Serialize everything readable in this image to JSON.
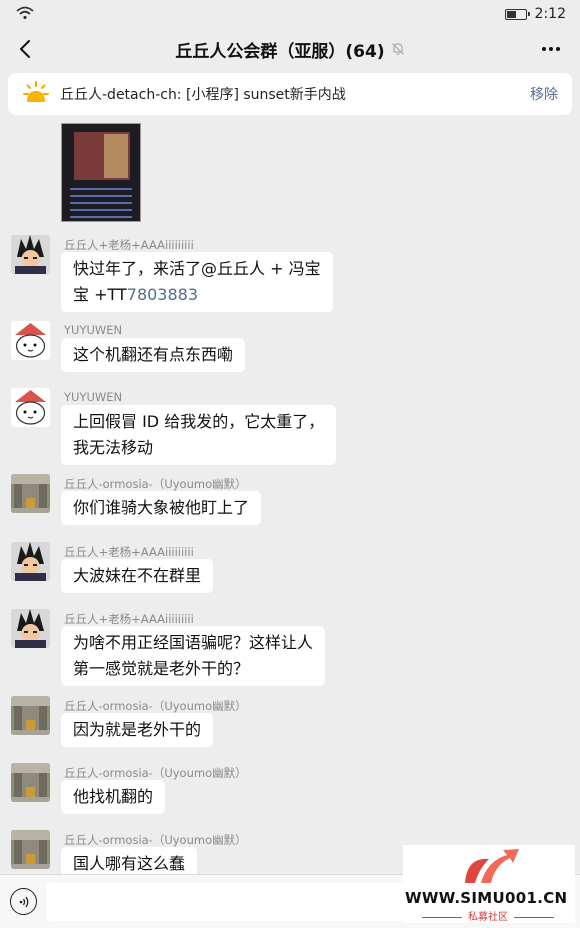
{
  "status_bar": {
    "time": "2:12"
  },
  "header": {
    "title": "丘丘人公会群（亚服）(64)",
    "muted": true
  },
  "pinned": {
    "text": "丘丘人-detach-ch: [小程序] sunset新手内战",
    "action": "移除"
  },
  "messages": [
    {
      "sender": "丘丘人+老杨+AAAiiiiiiiii",
      "avatar": "vegeta-avatar",
      "lines": [
        "快过年了，来活了@丘丘人 + 冯宝",
        "宝 +TT"
      ],
      "link": "7803883"
    },
    {
      "sender": "YUYUWEN",
      "avatar": "rice-hat-avatar",
      "lines": [
        "这个机翻还有点东西嘞"
      ]
    },
    {
      "sender": "YUYUWEN",
      "avatar": "rice-hat-avatar",
      "lines": [
        "上回假冒 ID 给我发的，它太重了，",
        "我无法移动"
      ]
    },
    {
      "sender": "丘丘人-ormosia-（Uyoumo幽默）",
      "avatar": "warehouse-avatar",
      "lines": [
        "你们谁骑大象被他盯上了"
      ]
    },
    {
      "sender": "丘丘人+老杨+AAAiiiiiiiii",
      "avatar": "vegeta-avatar",
      "lines": [
        "大波妹在不在群里"
      ]
    },
    {
      "sender": "丘丘人+老杨+AAAiiiiiiiii",
      "avatar": "vegeta-avatar",
      "lines": [
        "为啥不用正经国语骗呢？这样让人",
        "第一感觉就是老外干的？"
      ]
    },
    {
      "sender": "丘丘人-ormosia-（Uyoumo幽默）",
      "avatar": "warehouse-avatar",
      "lines": [
        "因为就是老外干的"
      ]
    },
    {
      "sender": "丘丘人-ormosia-（Uyoumo幽默）",
      "avatar": "warehouse-avatar",
      "lines": [
        "他找机翻的"
      ]
    },
    {
      "sender": "丘丘人-ormosia-（Uyoumo幽默）",
      "avatar": "warehouse-avatar",
      "lines": [
        "国人哪有这么蠢"
      ]
    }
  ],
  "watermark": {
    "site": "WWW.SIMU001.CN",
    "label": "私募社区"
  },
  "colors": {
    "link": "#576b95",
    "background": "#ededed",
    "bubble": "#ffffff"
  }
}
